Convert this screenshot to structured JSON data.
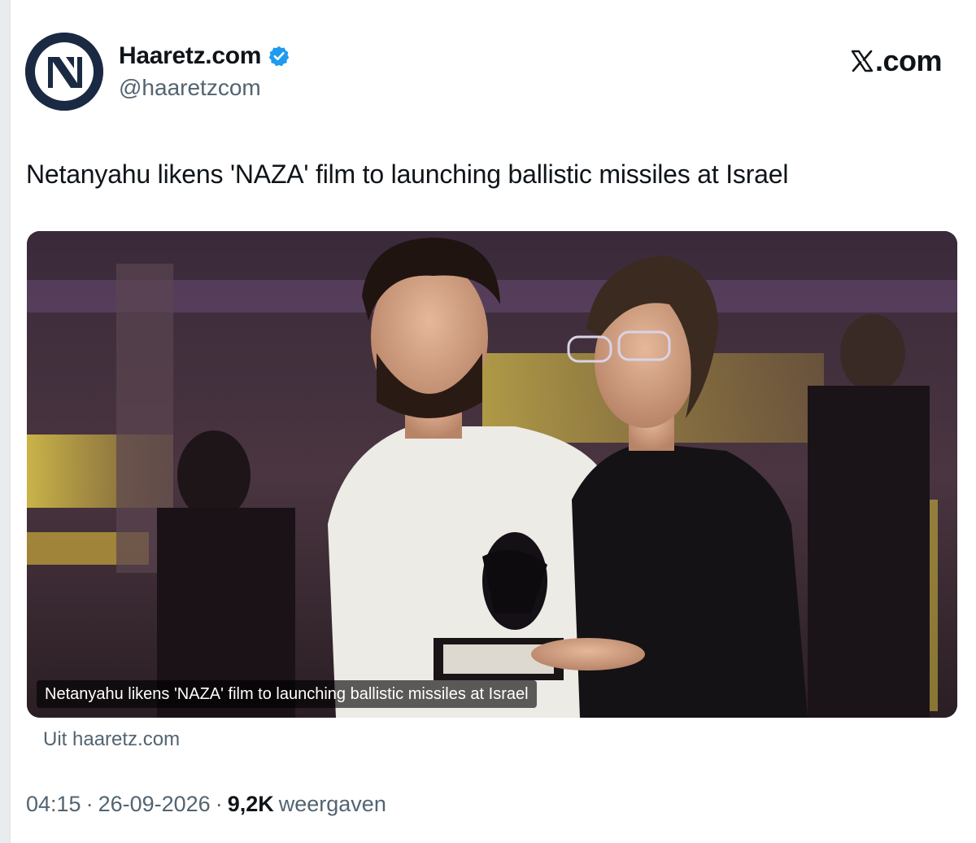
{
  "account": {
    "display_name": "Haaretz.com",
    "handle": "@haaretzcom",
    "verified": true,
    "avatar_icon": "haaretz-logo-icon"
  },
  "platform": {
    "logo_text": ".com",
    "logo_icon": "x-logo-icon"
  },
  "tweet": {
    "text": "Netanyahu likens 'NAZA' film to launching ballistic missiles at Israel"
  },
  "media": {
    "caption": "Netanyahu likens 'NAZA' film to launching ballistic missiles at Israel"
  },
  "source": {
    "label": "Uit haaretz.com"
  },
  "meta": {
    "time": "04:15",
    "separator": "·",
    "date": "26-09-2026",
    "views_count": "9,2K",
    "views_label": "weergaven"
  },
  "colors": {
    "text_primary": "#0f1419",
    "text_secondary": "#536471",
    "verified_blue": "#1d9bf0",
    "avatar_bg": "#1b2a43"
  }
}
